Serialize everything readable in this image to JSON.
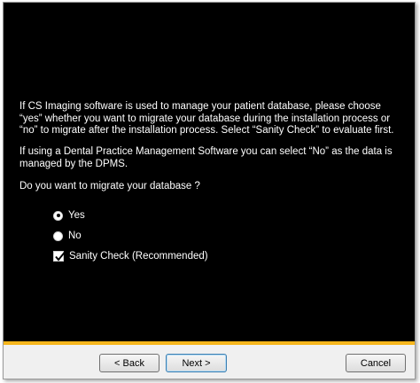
{
  "dialog": {
    "paragraph1_line1": "If CS Imaging software is used to manage your patient database, please choose",
    "paragraph1_line2": "“yes” whether you want to migrate your database during the installation process or",
    "paragraph1_line3": "“no” to migrate after the installation process. Select “Sanity Check” to evaluate first.",
    "paragraph2_line1": "If using a Dental Practice Management Software you can select “No” as the data is",
    "paragraph2_line2": "managed by the DPMS.",
    "question": "Do you want to migrate your database ?"
  },
  "options": {
    "yes_label": "Yes",
    "no_label": "No",
    "sanity_label": "Sanity Check (Recommended)",
    "selected": "Yes",
    "sanity_checked": true
  },
  "footer": {
    "back_label": "< Back",
    "next_label": "Next >",
    "cancel_label": "Cancel"
  },
  "colors": {
    "content_background": "#000000",
    "accent_bar": "#f6b61c",
    "footer_background": "#f0f0f0"
  },
  "icons": {
    "radio_selected": "radio-selected-icon",
    "radio_unselected": "radio-unselected-icon",
    "checkbox_checked": "checkmark-icon"
  }
}
